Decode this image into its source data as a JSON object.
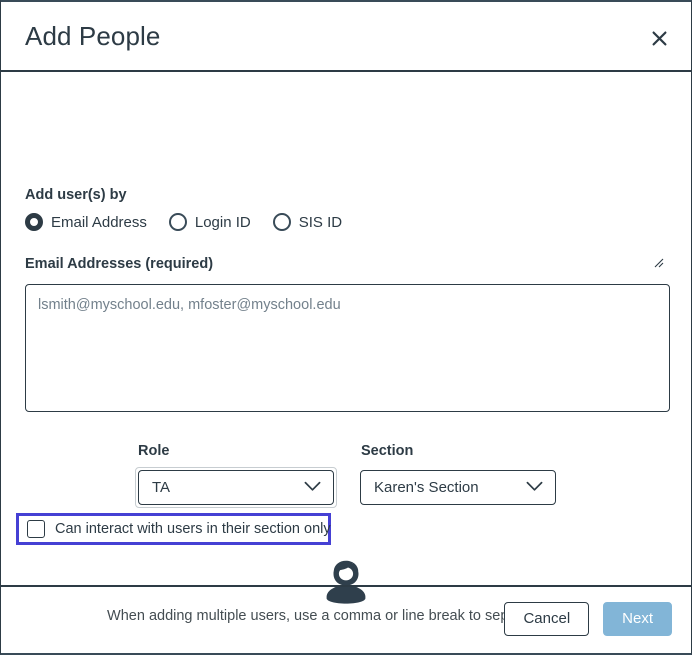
{
  "dialog": {
    "title": "Add People",
    "close_label": "close-icon"
  },
  "form": {
    "add_by_label": "Add user(s) by",
    "add_by_options": [
      {
        "label": "Email Address",
        "selected": true
      },
      {
        "label": "Login ID",
        "selected": false
      },
      {
        "label": "SIS ID",
        "selected": false
      }
    ],
    "email_label": "Email Addresses (required)",
    "email_value": "",
    "email_placeholder": "lsmith@myschool.edu, mfoster@myschool.edu",
    "role_label": "Role",
    "role_value": "TA",
    "section_label": "Section",
    "section_value": "Karen's Section",
    "section_only_label": "Can interact with users in their section only",
    "section_only_checked": false,
    "help_text": "When adding multiple users, use a comma or line break to separate users.",
    "avatar_icon": "person-icon"
  },
  "footer": {
    "cancel_label": "Cancel",
    "next_label": "Next"
  },
  "colors": {
    "text": "#2d3b45",
    "border": "#2d3b45",
    "highlight": "#4540d4",
    "next_button": "#82b5d7",
    "placeholder": "#73818c"
  }
}
